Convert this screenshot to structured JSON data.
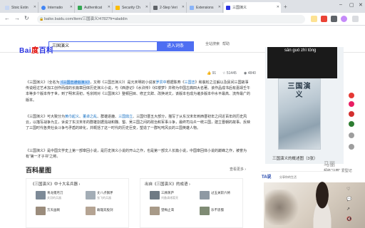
{
  "browser": {
    "tabs": [
      {
        "label": "Stoic Extin",
        "color": "#c7d6f2"
      },
      {
        "label": "Internatio",
        "color": "#4285f4"
      },
      {
        "label": "Authenticat",
        "color": "#34a853"
      },
      {
        "label": "Security Ch",
        "color": "#fbbc04"
      },
      {
        "label": "2-Step Veri",
        "color": "#5f6368"
      },
      {
        "label": "Extensions",
        "color": "#8ab4f8"
      },
      {
        "label": "三国演义",
        "color": "#2932e1"
      }
    ],
    "new_tab": "+",
    "url": "baike.baidu.com/item/三国演义/4782?fr=aladdin"
  },
  "baidu": {
    "logo_a": "Bai",
    "logo_b": "度",
    "logo_c": "百科",
    "search_value": "三国演义",
    "search_button": "进入词条",
    "header_links": [
      "全站搜索",
      "帮助"
    ]
  },
  "stats": {
    "likes": "91",
    "shares": "51445",
    "reads": "4840"
  },
  "overlay_text": "sān guó zhì tōng",
  "paragraphs": [
    [
      {
        "t": "《三国演义》（全名为"
      },
      {
        "t": "《三国志通俗演义》",
        "hl": true
      },
      {
        "t": "，又称《三国志演义》）是元末明初小说家"
      },
      {
        "t": "罗贯中",
        "lk": true
      },
      {
        "t": "根据陈寿《"
      },
      {
        "t": "三国志",
        "lk": true
      },
      {
        "t": "》和裴松之注解以及民间三国故事传说经过艺术加工创作而成的长篇章回体历史演义小说，与《西游记》《水浒传》《红楼梦》并称为中国古典四大名著。该作品成书后有嘉靖壬午本等多个版本传于世，到了明末清初，毛宗岗对《三国演义》整顿回目、修正文辞、改换诗文，该版本也成为诸多版本中水平最高、流传最广的版本。"
      }
    ],
    [
      {
        "t": "《三国演义》可大致分为"
      },
      {
        "t": "黄巾起义",
        "lk": true
      },
      {
        "t": "、"
      },
      {
        "t": "董卓之乱",
        "lk": true
      },
      {
        "t": "、群雄逐鹿、"
      },
      {
        "t": "三国鼎立",
        "lk": true
      },
      {
        "t": "、三国归晋五大部分，描写了从东汉末年到西晋初年之间近百年的历史风云，以描写战争为主，诉说了东汉末年的群雄割据混战和魏、蜀、吴三国之间的政治和军事斗争，最终司马炎一统三国，建立晋朝的故事。反映了三国时代各类社会斗争与矛盾的转化，并概括了这一时代的历史巨变，塑造了一群叱咤风云的三国英雄人物。"
      }
    ],
    [
      {
        "t": "《三国演义》是中国文学史上第一部章回小说，是历史演义小说的开山之作，也是第一部文人长篇小说，中国章回体小说的巅峰之作，被誉为有“第一才子书”之称。"
      }
    ]
  ],
  "section": {
    "title": "百科星图",
    "more": "查看更多 ›",
    "card1_title": "《三国演义》中十大名兵器 ›",
    "card2_title": "出自《三国演义》的成语 ›",
    "card1_items": [
      {
        "name": "青龙偃月刀",
        "sub": "关羽的兵器"
      },
      {
        "name": "丈八点钢矛",
        "sub": "张飞的兵器"
      },
      {
        "name": "方天画戟",
        "sub": ""
      },
      {
        "name": "雌雄双股剑",
        "sub": ""
      }
    ],
    "card2_items": [
      {
        "name": "三顾茅庐",
        "sub": "刘备请诸葛亮"
      },
      {
        "name": "过五关斩六将",
        "sub": ""
      },
      {
        "name": "望梅止渴",
        "sub": ""
      },
      {
        "name": "乐不思蜀",
        "sub": ""
      }
    ]
  },
  "book": {
    "title": "三国演义",
    "caption": "三国演义的概述图（3张）",
    "watermark": "马丽",
    "watermark_sub": "超级“马丽” 爱型记"
  },
  "ad": {
    "logo": "TA说",
    "text": "分享你的生活"
  }
}
